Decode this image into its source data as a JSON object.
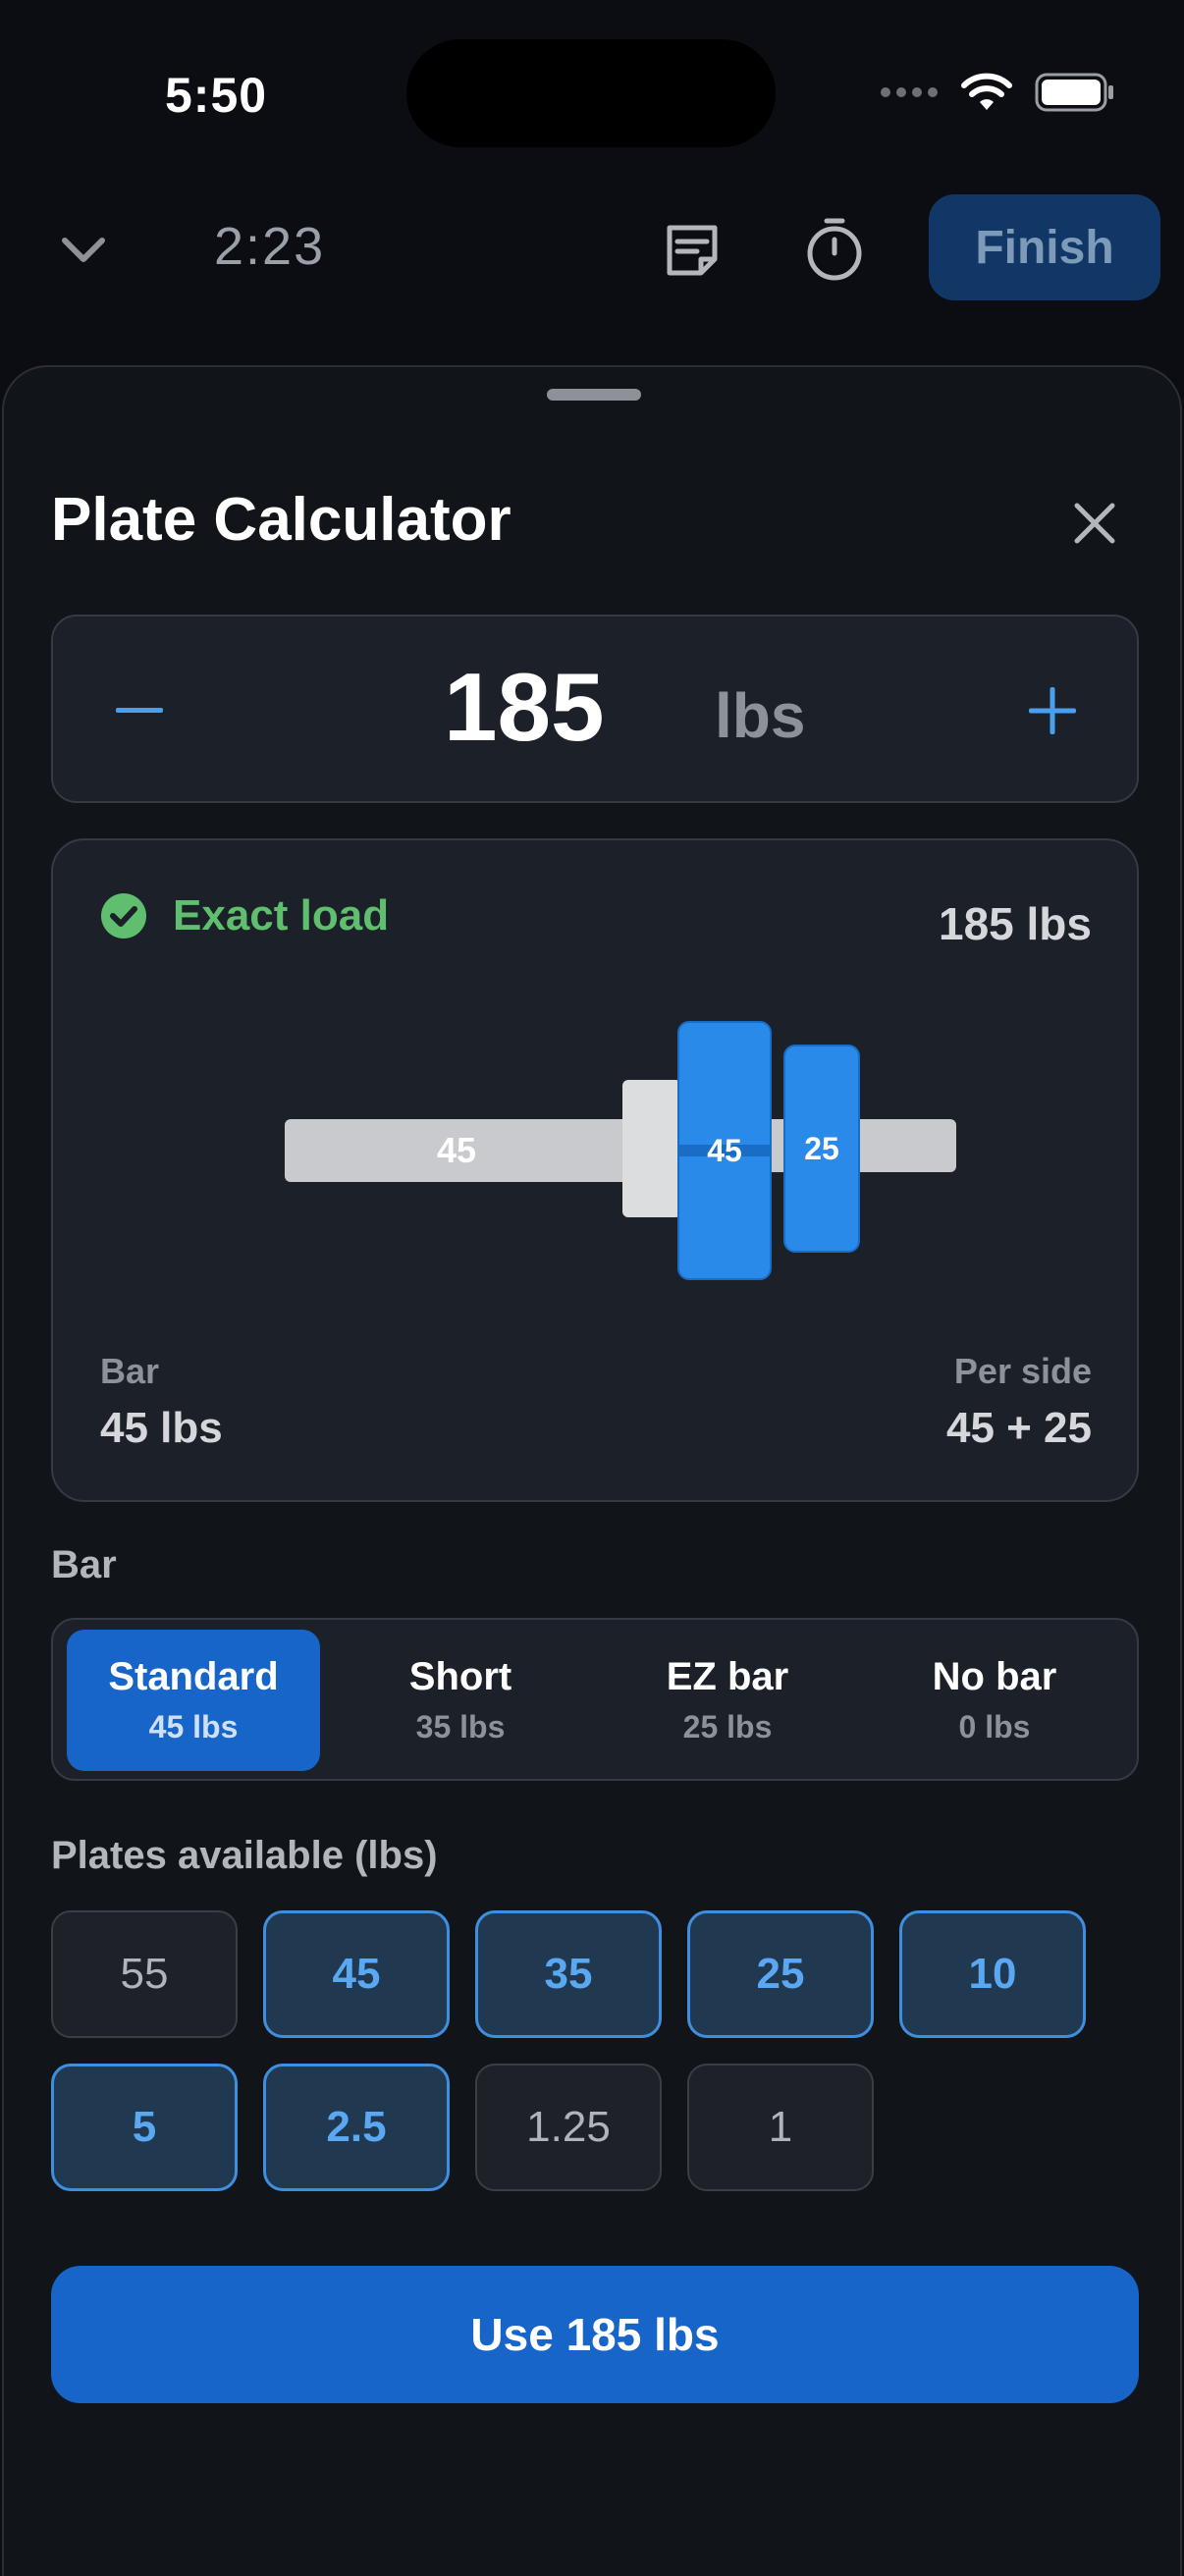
{
  "status_bar": {
    "time": "5:50"
  },
  "header": {
    "elapsed": "2:23",
    "finish_label": "Finish"
  },
  "sheet": {
    "title": "Plate Calculator",
    "weight": {
      "value": "185",
      "unit": "lbs"
    },
    "load": {
      "status": "Exact load",
      "total": "185 lbs",
      "bar_plate_label": "45",
      "plates_per_side": [
        "45",
        "25"
      ],
      "bar_title": "Bar",
      "bar_value": "45 lbs",
      "side_title": "Per side",
      "side_value": "45 + 25"
    },
    "bar_section_label": "Bar",
    "bar_options": [
      {
        "name": "Standard",
        "weight": "45 lbs",
        "selected": true
      },
      {
        "name": "Short",
        "weight": "35 lbs",
        "selected": false
      },
      {
        "name": "EZ bar",
        "weight": "25 lbs",
        "selected": false
      },
      {
        "name": "No bar",
        "weight": "0 lbs",
        "selected": false
      }
    ],
    "plates_label": "Plates available (lbs)",
    "plates": [
      {
        "value": "55",
        "enabled": false
      },
      {
        "value": "45",
        "enabled": true
      },
      {
        "value": "35",
        "enabled": true
      },
      {
        "value": "25",
        "enabled": true
      },
      {
        "value": "10",
        "enabled": true
      },
      {
        "value": "5",
        "enabled": true
      },
      {
        "value": "2.5",
        "enabled": true
      },
      {
        "value": "1.25",
        "enabled": false
      },
      {
        "value": "1",
        "enabled": false
      }
    ],
    "use_button_label": "Use 185 lbs"
  },
  "colors": {
    "accent": "#1865c9",
    "plate": "#2a8aea",
    "success": "#5fbf6e",
    "background": "#0b0d12"
  }
}
